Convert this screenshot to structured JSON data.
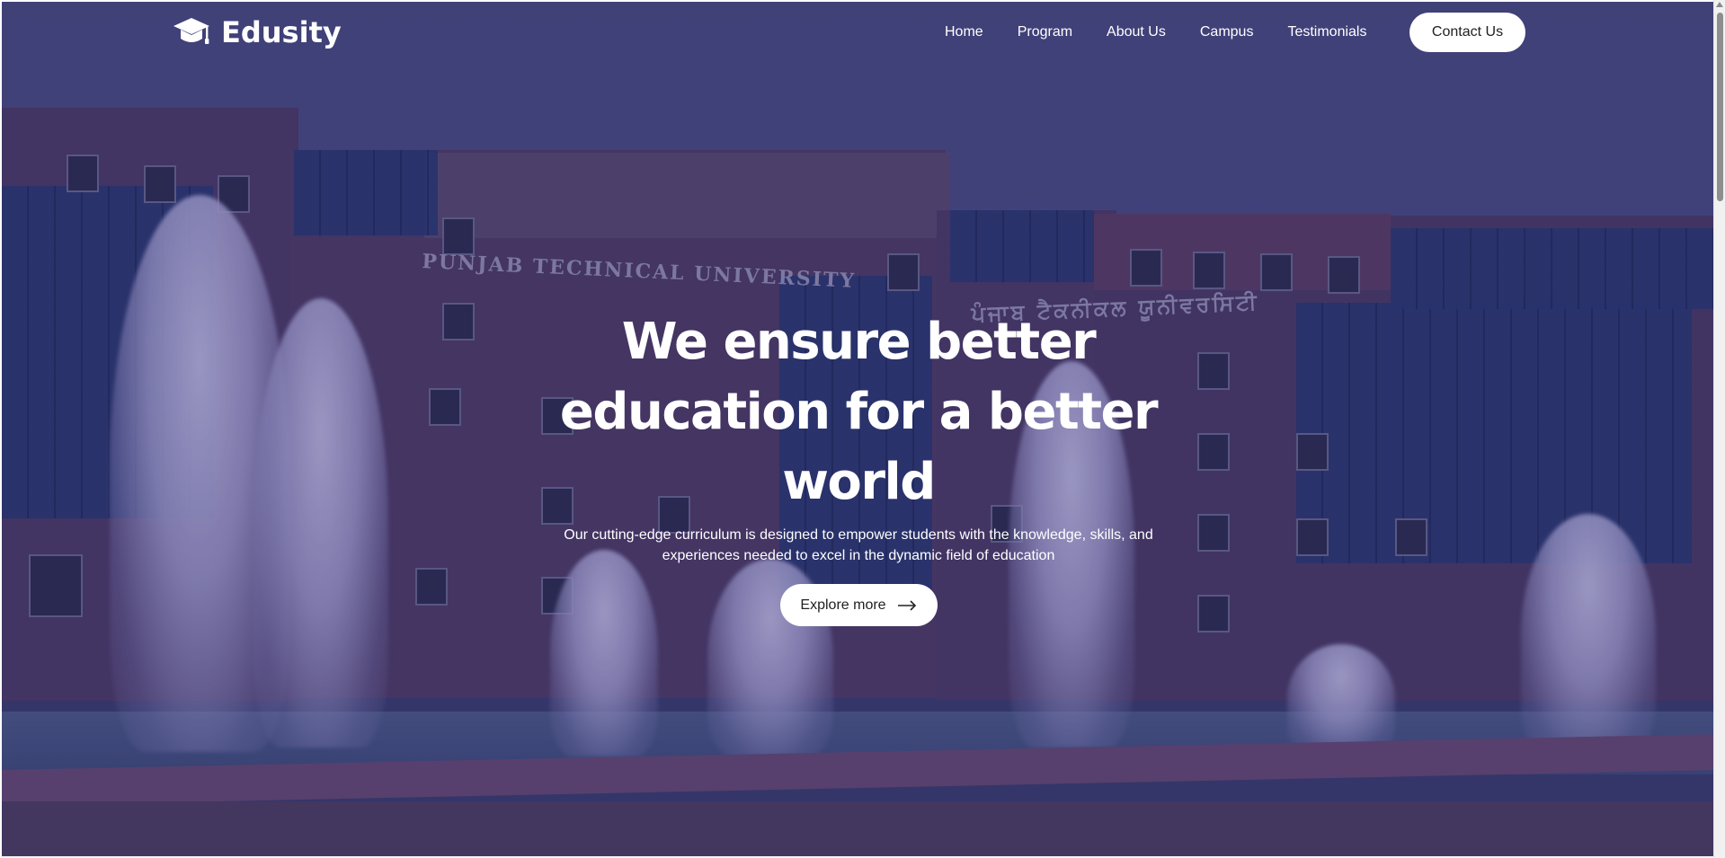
{
  "brand": {
    "name": "Edusity",
    "icon": "graduation-cap-icon"
  },
  "nav": {
    "items": [
      {
        "label": "Home"
      },
      {
        "label": "Program"
      },
      {
        "label": "About Us"
      },
      {
        "label": "Campus"
      },
      {
        "label": "Testimonials"
      }
    ],
    "contact_label": "Contact Us"
  },
  "hero": {
    "title": "We ensure better education for a better world",
    "subtitle": "Our cutting-edge curriculum is designed to empower students with the knowledge, skills, and experiences needed to excel in the dynamic field of education",
    "cta_label": "Explore more",
    "cta_icon": "arrow-right-icon",
    "background": {
      "sign_text": "PUNJAB TECHNICAL UNIVERSITY",
      "sign_text_local": "ਪੰਜਾਬ ਟੈਕਨੀਕਲ ਯੂਨੀਵਰਸਿਟੀ"
    }
  },
  "colors": {
    "overlay": "#28266a",
    "button_bg": "#ffffff",
    "button_text": "#212121",
    "nav_text": "#ffffff"
  }
}
